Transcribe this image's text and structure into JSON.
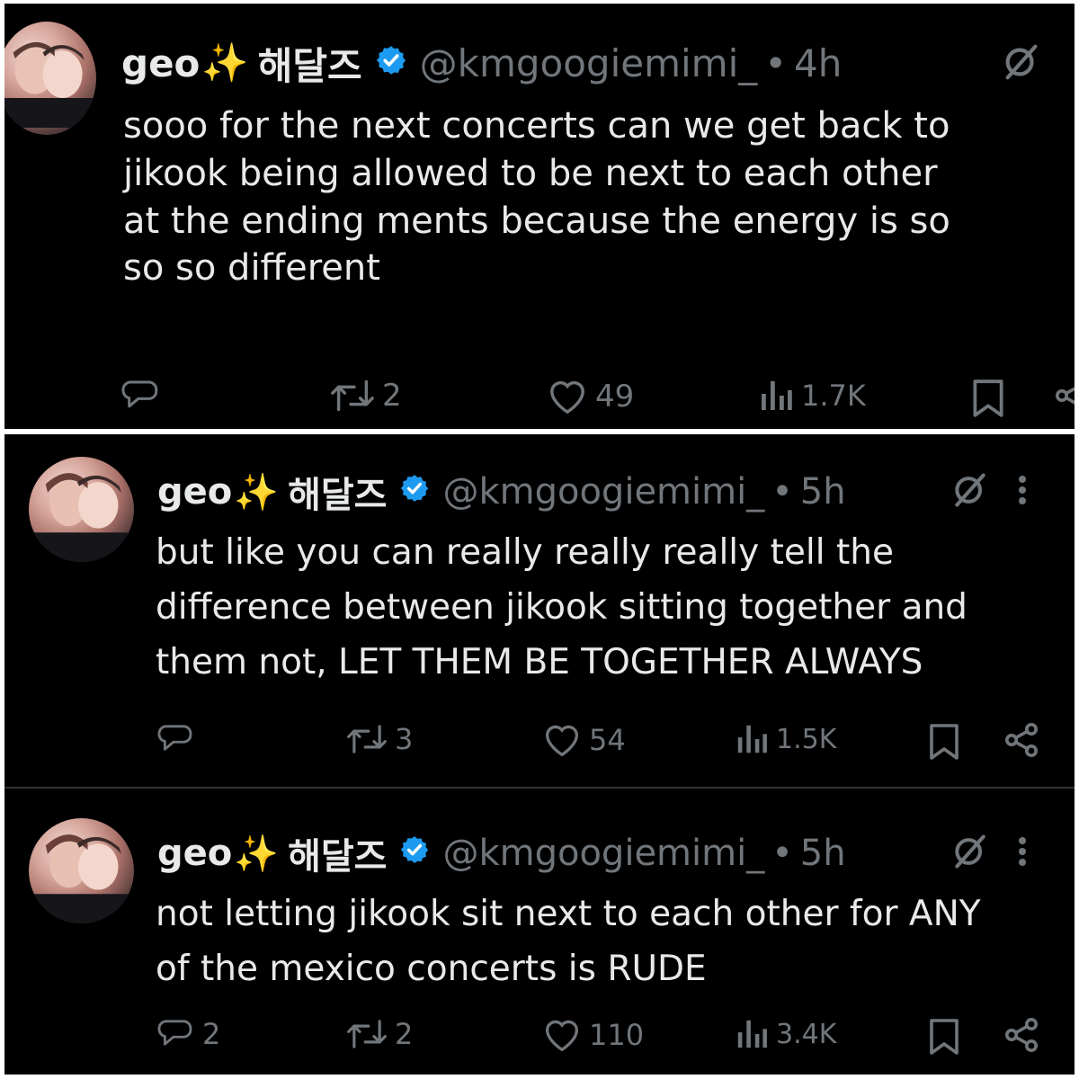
{
  "tweets": [
    {
      "display_name": "geo",
      "emoji": "✨",
      "korean_name": "해달즈",
      "handle": "@kmgoogiemimi_",
      "separator": "•",
      "time": "4h",
      "text": "sooo for the next concerts can we get back to\njikook being allowed to be next to each other\nat the ending ments because the energy is so\nso so different",
      "replies": "",
      "reposts": "2",
      "likes": "49",
      "views": "1.7K"
    },
    {
      "display_name": "geo",
      "emoji": "✨",
      "korean_name": "해달즈",
      "handle": "@kmgoogiemimi_",
      "separator": "•",
      "time": "5h",
      "text": "but like you can really really really tell the\ndifference between jikook sitting together and\nthem not, LET THEM BE TOGETHER ALWAYS",
      "replies": "",
      "reposts": "3",
      "likes": "54",
      "views": "1.5K"
    },
    {
      "display_name": "geo",
      "emoji": "✨",
      "korean_name": "해달즈",
      "handle": "@kmgoogiemimi_",
      "separator": "•",
      "time": "5h",
      "text": "not letting jikook sit next to each other for ANY\nof the mexico concerts is RUDE",
      "replies": "2",
      "reposts": "2",
      "likes": "110",
      "views": "3.4K"
    }
  ],
  "colors": {
    "background": "#000000",
    "primary_text": "#e7e9ea",
    "secondary_text": "#71767b",
    "verified_blue": "#1d9bf0",
    "sparkle": "#f7c531"
  },
  "icons": [
    "reply-icon",
    "repost-icon",
    "like-icon",
    "views-icon",
    "bookmark-icon",
    "share-icon",
    "grok-icon",
    "more-icon",
    "verified-badge-icon"
  ]
}
